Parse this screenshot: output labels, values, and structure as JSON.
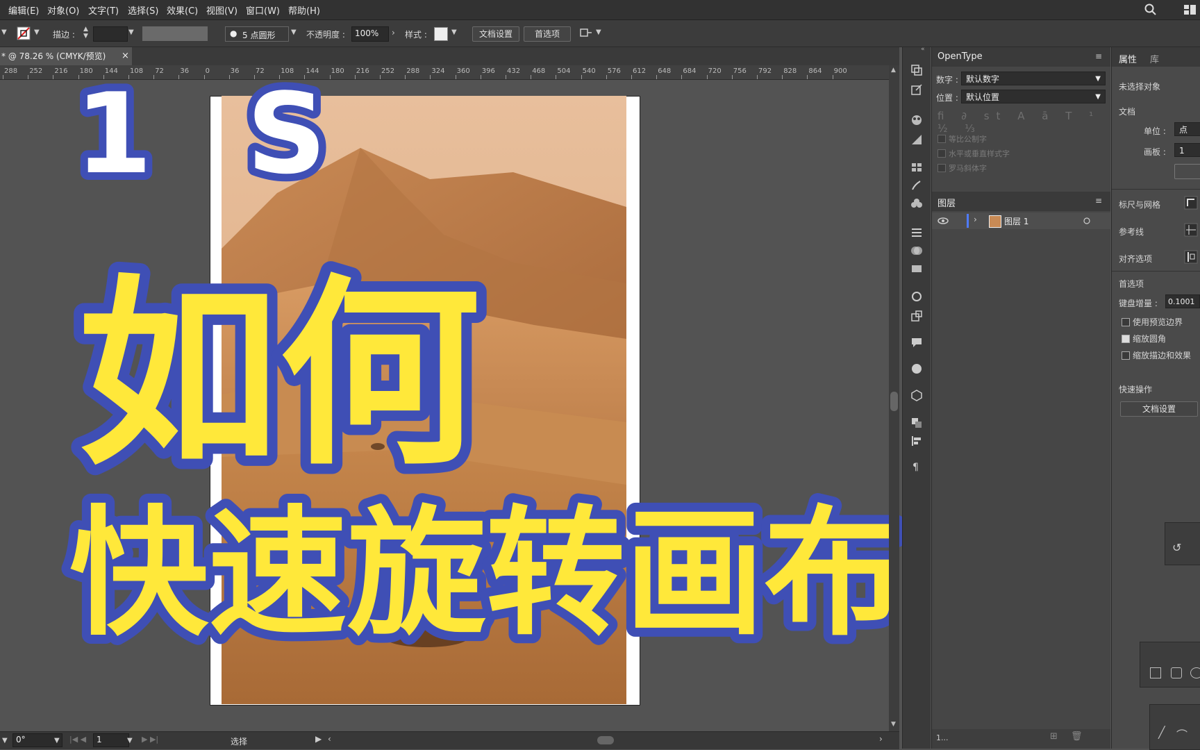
{
  "menu": [
    "编辑(E)",
    "对象(O)",
    "文字(T)",
    "选择(S)",
    "效果(C)",
    "视图(V)",
    "窗口(W)",
    "帮助(H)"
  ],
  "control": {
    "stroke_label": "描边 :",
    "brush_value": "5 点圆形",
    "opacity_label": "不透明度 :",
    "opacity_value": "100%",
    "style_label": "样式 :",
    "doc_setup": "文档设置",
    "prefs": "首选项"
  },
  "document_tab": {
    "title": "* @ 78.26 % (CMYK/预览)",
    "close": "×"
  },
  "ruler_ticks": [
    "288",
    "252",
    "216",
    "180",
    "144",
    "108",
    "72",
    "36",
    "0",
    "36",
    "72",
    "108",
    "144",
    "180",
    "216",
    "252",
    "288",
    "324",
    "360",
    "396",
    "432",
    "468",
    "504",
    "540",
    "576",
    "612",
    "648",
    "684",
    "720",
    "756",
    "792",
    "828",
    "864",
    "900"
  ],
  "overlay": {
    "line1": "1 S",
    "line2": "如何",
    "line3": "快速旋转画布",
    "fill_color": "#ffe83a",
    "stroke_color": "#3f4fb5"
  },
  "opentype": {
    "title": "OpenType",
    "number_label": "数字 :",
    "number_value": "默认数字",
    "position_label": "位置 :",
    "position_value": "默认位置",
    "options": [
      "等比公制字",
      "水平或垂直样式字",
      "罗马斜体字"
    ]
  },
  "layers": {
    "title": "图层",
    "layer_name": "图层 1",
    "footer_count": "1..."
  },
  "properties": {
    "tab_props": "属性",
    "tab_lib": "库",
    "no_selection": "未选择对象",
    "doc_section": "文档",
    "unit_label": "单位 :",
    "unit_value": "点",
    "artboard_label": "画板 :",
    "artboard_value": "1",
    "rulers_grid": "标尺与网格",
    "guides": "参考线",
    "align": "对齐选项",
    "prefs_section": "首选项",
    "key_increment_label": "键盘增量 :",
    "key_increment_value": "0.1001",
    "opt_preview_bounds": "使用预览边界",
    "opt_scale_corners": "缩放圆角",
    "opt_scale_strokes": "缩放描边和效果",
    "quick_actions": "快速操作",
    "quick_doc_setup": "文档设置"
  },
  "status": {
    "rotation": "0°",
    "page": "1",
    "tool": "选择"
  }
}
